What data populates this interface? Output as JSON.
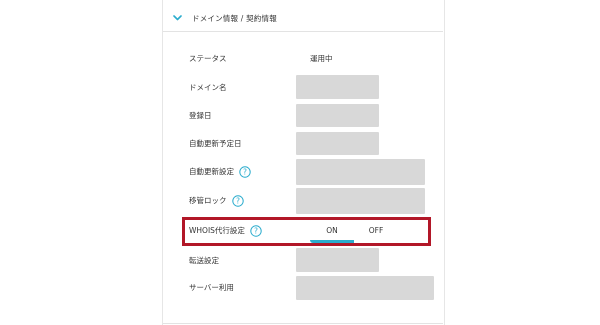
{
  "section": {
    "title": "ドメイン情報 / 契約情報",
    "toggle_icon": "chevron-down-icon",
    "accent_color": "#2baccd"
  },
  "rows": [
    {
      "key": "status",
      "label": "ステータス",
      "value": "運用中"
    },
    {
      "key": "domain",
      "label": "ドメイン名",
      "value": ""
    },
    {
      "key": "registered",
      "label": "登録日",
      "value": ""
    },
    {
      "key": "renewal_date",
      "label": "自動更新予定日",
      "value": ""
    },
    {
      "key": "auto_renew",
      "label": "自動更新設定",
      "value": "",
      "help_icon": "question-circle-icon"
    },
    {
      "key": "transfer_lock",
      "label": "移管ロック",
      "value": "",
      "help_icon": "question-circle-icon"
    },
    {
      "key": "whois",
      "label": "WHOIS代行設定",
      "help_icon": "question-circle-icon",
      "toggle": {
        "on_label": "ON",
        "off_label": "OFF",
        "selected": "ON"
      }
    },
    {
      "key": "forwarding",
      "label": "転送設定",
      "value": ""
    },
    {
      "key": "server",
      "label": "サーバー利用",
      "value": ""
    }
  ],
  "highlight_color": "#b21728"
}
